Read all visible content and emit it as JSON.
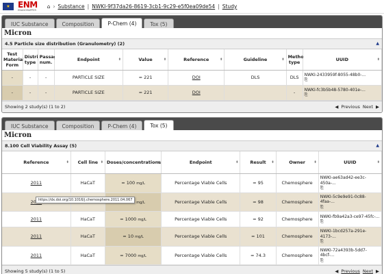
{
  "header": {
    "logo_text": "ENM",
    "logo_sub": "ENANOMAPPER",
    "crumbs": [
      "Substance",
      "NWKI-9f37da26-8619-3cb1-9c29-e5f0ea09de54",
      "Study"
    ]
  },
  "panel1": {
    "tabs": [
      "IUC Substance",
      "Composition",
      "P-Chem (4)",
      "Tox (5)"
    ],
    "active_tab": 2,
    "title": "Micron",
    "section": "4.5 Particle size distribution (Granulometry) (2)",
    "columns": [
      "Test Material Form",
      "Distrib. type",
      "Passage num.",
      "Endpoint",
      "Value",
      "Reference",
      "Guideline",
      "Method type",
      "UUID"
    ],
    "rows": [
      {
        "form": "-",
        "distrib": "-",
        "passage": "-",
        "endpoint": "PARTICLE SIZE",
        "value": "= 221",
        "reference": "DOI",
        "guideline": "DLS",
        "method": "DLS",
        "uuid": "NWKI-2433959f-8055-48b0-..."
      },
      {
        "form": "-",
        "distrib": "-",
        "passage": "-",
        "endpoint": "PARTICLE SIZE",
        "value": "= 221",
        "reference": "DOI",
        "guideline": "",
        "method": "-",
        "uuid": "NWKI-fc3b5b48-5780-401e-..."
      }
    ],
    "footer": "Showing 2 study(s) (1 to 2)",
    "prev": "Previous",
    "next": "Next"
  },
  "panel2": {
    "tabs": [
      "IUC Substance",
      "Composition",
      "P-Chem (4)",
      "Tox (5)"
    ],
    "active_tab": 3,
    "title": "Micron",
    "section": "8.100 Cell Viability Assay (5)",
    "columns": [
      "Reference",
      "Cell line",
      "Doses/concentrations",
      "Endpoint",
      "Result",
      "Owner",
      "UUID"
    ],
    "rows": [
      {
        "reference": "2011",
        "cell": "HaCaT",
        "dose": "= 100",
        "unit": "mg/L",
        "endpoint": "Percentage Viable Cells",
        "result": "= 95",
        "owner": "Chemosphere",
        "uuid": "NWKI-ae63ad42-ee3c-450a-..."
      },
      {
        "reference": "2011",
        "cell": "HaCaT",
        "dose": "= 500",
        "unit": "mg/L",
        "endpoint": "Percentage Viable Cells",
        "result": "= 98",
        "owner": "Chemosphere",
        "uuid": "NWKI-5c9e9e91-0c88-4faa-..."
      },
      {
        "reference": "2011",
        "cell": "HaCaT",
        "dose": "= 1000",
        "unit": "mg/L",
        "endpoint": "Percentage Viable Cells",
        "result": "= 92",
        "owner": "Chemosphere",
        "uuid": "NWKI-fb9a42a3-ce97-45fc-..."
      },
      {
        "reference": "2011",
        "cell": "HaCaT",
        "dose": "= 10",
        "unit": "mg/L",
        "endpoint": "Percentage Viable Cells",
        "result": "= 101",
        "owner": "Chemosphere",
        "uuid": "NWKI-1bcd257a-291e-4173-..."
      },
      {
        "reference": "2011",
        "cell": "HaCaT",
        "dose": "= 7000",
        "unit": "mg/L",
        "endpoint": "Percentage Viable Cells",
        "result": "= 74.3",
        "owner": "Chemosphere",
        "uuid": "NWKI-72a4393b-5dd7-4bcf-..."
      }
    ],
    "footer": "Showing 5 study(s) (1 to 5)",
    "prev": "Previous",
    "next": "Next",
    "tooltip": "https://dx.doi.org/10.1016/j.chemosphere.2011.04.067"
  }
}
